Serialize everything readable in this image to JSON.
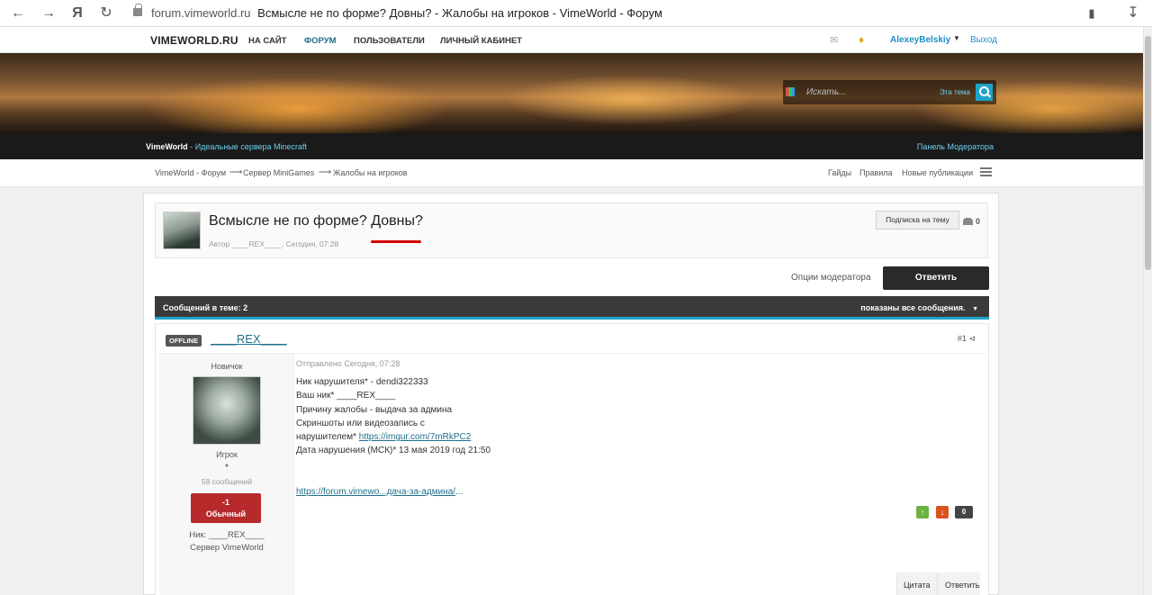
{
  "browser": {
    "url_domain": "forum.vimeworld.ru",
    "tab_title": "Всмысле не по форме? Довны? - Жалобы на игроков - VimeWorld - Форум",
    "yandex_glyph": "Я"
  },
  "site_nav": {
    "logo": "VIMEWORLD.RU",
    "items": [
      "НА САЙТ",
      "ФОРУМ",
      "ПОЛЬЗОВАТЕЛИ",
      "ЛИЧНЫЙ КАБИНЕТ"
    ],
    "username": "AlexeyBelskiy",
    "logout": "Выход"
  },
  "banner": {
    "search_placeholder": "Искать...",
    "search_scope": "Эта тема"
  },
  "subbar": {
    "brand": "VimeWorld",
    "tagline": "- Идеальные сервера Minecraft",
    "mod_panel": "Панель Модератора"
  },
  "breadcrumb": [
    "VimeWorld - Форум",
    "Сервер MiniGames",
    "Жалобы на игроков"
  ],
  "tools": [
    "Гайды",
    "Правила",
    "Новые публикации"
  ],
  "topic": {
    "title": "Всмысле не по форме? Довны?",
    "meta": "Автор ____REX____, Сегодня, 07:28",
    "follow_label": "Подписка на тему",
    "followers": "0",
    "mod_options": "Опции модератора",
    "reply_label": "Ответить",
    "posts_count_label": "Сообщений в теме: 2",
    "shown_label": "показаны все сообщения."
  },
  "post": {
    "status": "OFFLINE",
    "author": "____REX____",
    "number": "#1",
    "rank": "Новичок",
    "group": "Игрок",
    "dot": "●",
    "messages": "58 сообщений",
    "rep_value": "-1",
    "rep_label": "Обычный",
    "nick_line": "Ник: ____REX____",
    "server_line": "Сервер VimeWorld",
    "posted_at": "Отправлено Сегодня, 07:28",
    "lines": [
      "Ник нарушителя* - dendi322333",
      "Ваш ник* ____REX____",
      "Причину жалобы - выдача за админа",
      "Скриншоты или видеозапись с"
    ],
    "proof_prefix": "нарушителем*",
    "proof_link": "https://imgur.com/7mRkPC2",
    "violation_date": "Дата нарушения (МСК)* 13 мая 2019 год 21:50",
    "footer_link": "https://forum.vimewo...дача-за-админа/",
    "ellipsis": "...",
    "vote_count": "0",
    "quote_label": "Цитата",
    "reply_label": "Ответить"
  }
}
